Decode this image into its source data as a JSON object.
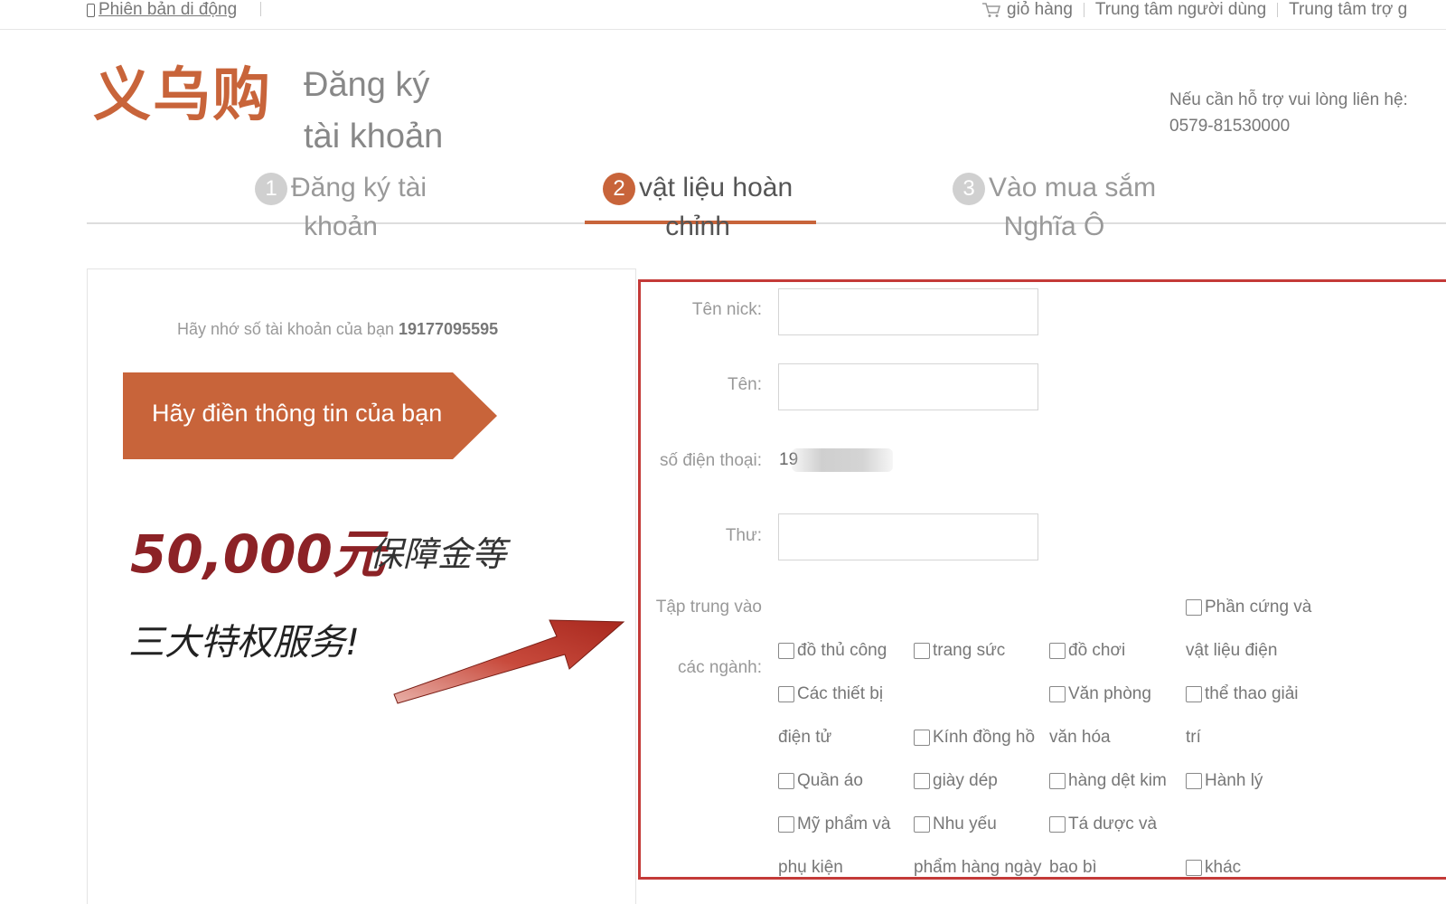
{
  "topbar": {
    "mobile_version": "Phiên bản di động",
    "cart": "giỏ hàng",
    "user_center": "Trung tâm người dùng",
    "help_center": "Trung tâm trợ g"
  },
  "header": {
    "logo": "义乌购",
    "page_title_line1": "Đăng ký",
    "page_title_line2": "tài khoản",
    "support_line1": "Nếu cần hỗ trợ vui lòng liên hệ:",
    "support_phone": "0579-81530000"
  },
  "steps": [
    {
      "num": "1",
      "line1": "Đăng ký tài",
      "line2": "khoản"
    },
    {
      "num": "2",
      "line1": "vật liệu hoàn",
      "line2": "chỉnh"
    },
    {
      "num": "3",
      "line1": "Vào mua sắm",
      "line2": "Nghĩa Ô"
    }
  ],
  "left": {
    "remember_text": "Hãy nhớ số tài khoản của bạn",
    "account_number": "19177095595",
    "banner": "Hãy điền thông tin của bạn",
    "money": "50,000元",
    "money_sub": "保障金等",
    "privilege": "三大特权服务!"
  },
  "form": {
    "nick_label": "Tên nick:",
    "name_label": "Tên:",
    "phone_label": "số điện thoại:",
    "phone_value": "19",
    "mail_label": "Thư:",
    "focus_label_1": "Tập trung vào",
    "focus_label_2": "các ngành:",
    "categories": {
      "handicraft": "đồ thủ công",
      "jewelry": "trang sức",
      "toys": "đồ chơi",
      "hardware_1": "Phần cứng và",
      "hardware_2": "vật liệu điện",
      "electronics_1": "Các thiết bị",
      "electronics_2": "điện tử",
      "office_1": "Văn phòng",
      "office_2": "văn hóa",
      "sports_1": "thể thao giải",
      "sports_2": "trí",
      "glasses": "Kính đồng hồ",
      "clothing": "Quần áo",
      "shoes": "giày dép",
      "knit": "hàng dệt kim",
      "luggage": "Hành lý",
      "cosmetics_1": "Mỹ phẩm và",
      "cosmetics_2": "phụ kiện",
      "daily_1": "Nhu yếu",
      "daily_2": "phẩm hàng ngày",
      "packaging_1": "Tá dược và",
      "packaging_2": "bao bì",
      "other": "khác"
    }
  },
  "colors": {
    "accent": "#c8643a",
    "frame": "#c43a38",
    "money": "#8c2226"
  },
  "icons": [
    "phone-icon",
    "cart-icon",
    "arrow-icon"
  ]
}
